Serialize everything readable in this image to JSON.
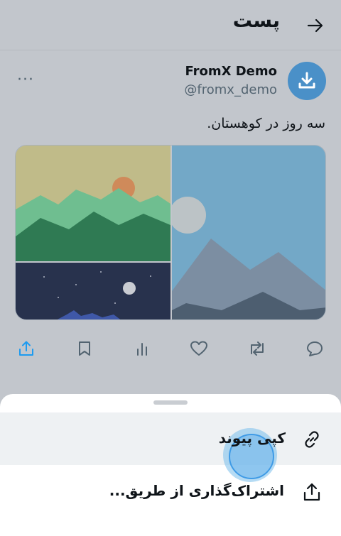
{
  "header": {
    "title": "پست",
    "back_icon": "arrow-right-icon"
  },
  "post": {
    "author_name": "FromX Demo",
    "author_handle": "@fromx_demo",
    "avatar_icon": "download-icon",
    "avatar_color": "#4a90c8",
    "more_label": "···",
    "text": "سه روز در کوهستان."
  },
  "actions": [
    {
      "name": "reply-icon"
    },
    {
      "name": "repost-icon"
    },
    {
      "name": "like-icon"
    },
    {
      "name": "views-icon"
    },
    {
      "name": "bookmark-icon"
    },
    {
      "name": "share-icon"
    }
  ],
  "share_sheet": {
    "items": [
      {
        "label": "کپی پیوند",
        "icon": "link-icon"
      },
      {
        "label": "اشتراک‌گذاری از طریق...",
        "icon": "share-icon"
      }
    ]
  },
  "colors": {
    "accent": "#1d9bf0",
    "background_dim": "#c2c6cc"
  }
}
